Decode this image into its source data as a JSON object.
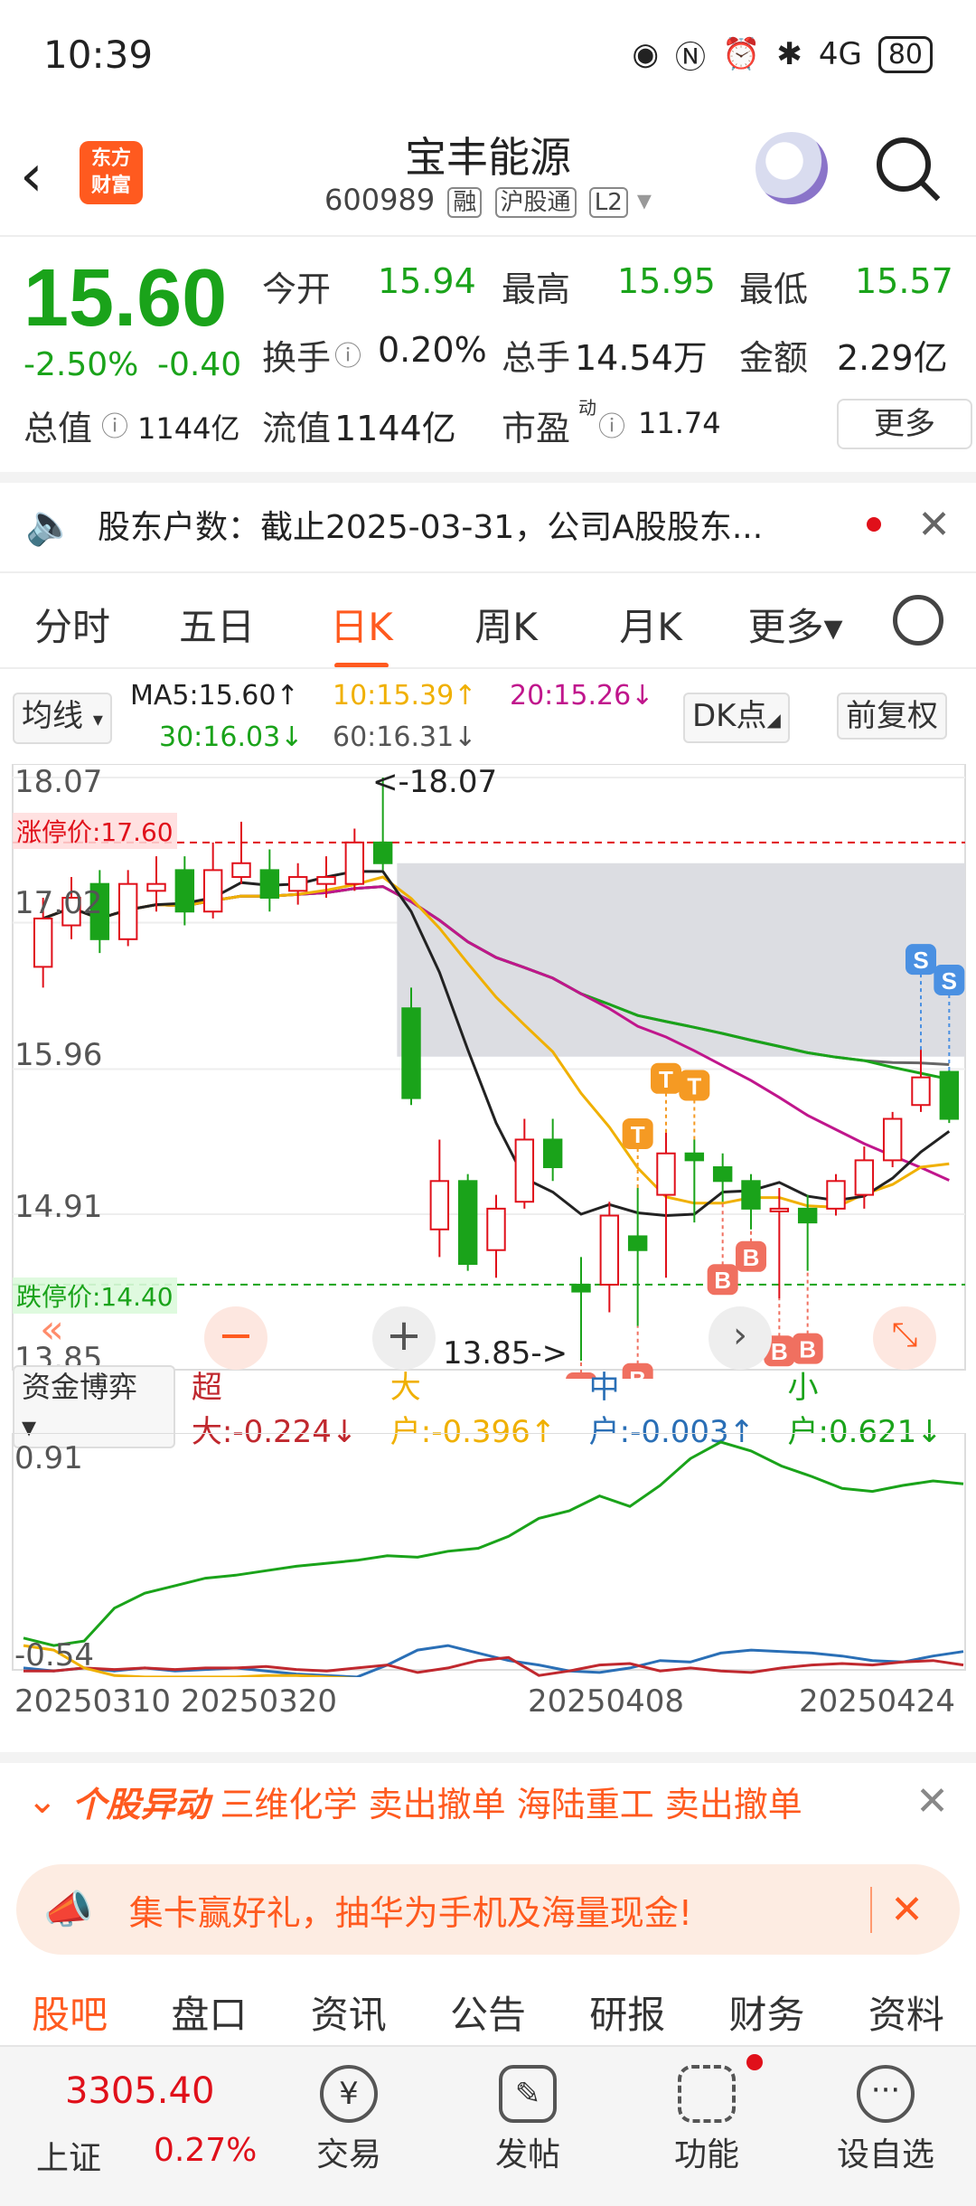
{
  "status": {
    "time": "10:39",
    "signal": "4G",
    "battery": "80"
  },
  "header": {
    "title": "宝丰能源",
    "code": "600989",
    "tags": [
      "融",
      "沪股通",
      "L2"
    ],
    "logo_text": [
      "东方",
      "财富"
    ]
  },
  "quote": {
    "price": "15.60",
    "change_pct": "-2.50%",
    "change": "-0.40",
    "open_label": "今开",
    "open": "15.94",
    "high_label": "最高",
    "high": "15.95",
    "low_label": "最低",
    "low": "15.57",
    "turnover_label": "换手",
    "turnover": "0.20%",
    "volume_label": "总手",
    "volume": "14.54万",
    "amount_label": "金额",
    "amount": "2.29亿",
    "mktcap_label": "总值",
    "mktcap": "1144亿",
    "float_label": "流值",
    "float": "1144亿",
    "pe_label": "市盈",
    "pe_sup": "动",
    "pe": "11.74",
    "more": "更多"
  },
  "notice": {
    "text": "股东户数：截止2025-03-31，公司A股股东..."
  },
  "tabs": [
    "分时",
    "五日",
    "日K",
    "周K",
    "月K",
    "更多▾"
  ],
  "active_tab": 2,
  "ma": {
    "selector": "均线",
    "ma5": "MA5:15.60↑",
    "ma10": "10:15.39↑",
    "ma20": "20:15.26↓",
    "ma30": "30:16.03↓",
    "ma60": "60:16.31↓",
    "dk": "DK点",
    "adjust": "前复权"
  },
  "chart_data": {
    "type": "candlestick",
    "y_ticks": [
      "18.07",
      "17.02",
      "15.96",
      "14.91",
      "13.85"
    ],
    "limit_up_label": "涨停价:17.60",
    "limit_down_label": "跌停价:14.40",
    "max_label": "<-18.07",
    "min_label": "13.85->",
    "ylim": [
      13.85,
      18.07
    ],
    "candles": [
      {
        "o": 16.7,
        "c": 17.05,
        "h": 17.2,
        "l": 16.55
      },
      {
        "o": 17.0,
        "c": 17.2,
        "h": 17.35,
        "l": 16.9
      },
      {
        "o": 17.3,
        "c": 16.9,
        "h": 17.4,
        "l": 16.8
      },
      {
        "o": 16.9,
        "c": 17.3,
        "h": 17.4,
        "l": 16.85
      },
      {
        "o": 17.25,
        "c": 17.3,
        "h": 17.5,
        "l": 17.1
      },
      {
        "o": 17.4,
        "c": 17.1,
        "h": 17.5,
        "l": 17.0
      },
      {
        "o": 17.1,
        "c": 17.4,
        "h": 17.6,
        "l": 17.05
      },
      {
        "o": 17.35,
        "c": 17.45,
        "h": 17.75,
        "l": 17.3
      },
      {
        "o": 17.4,
        "c": 17.2,
        "h": 17.55,
        "l": 17.1
      },
      {
        "o": 17.25,
        "c": 17.35,
        "h": 17.45,
        "l": 17.15
      },
      {
        "o": 17.3,
        "c": 17.35,
        "h": 17.5,
        "l": 17.2
      },
      {
        "o": 17.3,
        "c": 17.6,
        "h": 17.7,
        "l": 17.25
      },
      {
        "o": 17.6,
        "c": 17.45,
        "h": 18.07,
        "l": 17.4
      },
      {
        "o": 16.4,
        "c": 15.75,
        "h": 16.55,
        "l": 15.7
      },
      {
        "o": 14.8,
        "c": 15.15,
        "h": 15.45,
        "l": 14.6
      },
      {
        "o": 15.15,
        "c": 14.55,
        "h": 15.2,
        "l": 14.5
      },
      {
        "o": 14.65,
        "c": 14.95,
        "h": 15.05,
        "l": 14.45
      },
      {
        "o": 15.0,
        "c": 15.45,
        "h": 15.6,
        "l": 14.95
      },
      {
        "o": 15.45,
        "c": 15.25,
        "h": 15.6,
        "l": 15.15
      },
      {
        "o": 14.4,
        "c": 14.35,
        "h": 14.6,
        "l": 13.85
      },
      {
        "o": 14.4,
        "c": 14.9,
        "h": 15.0,
        "l": 14.2
      },
      {
        "o": 14.75,
        "c": 14.65,
        "h": 15.1,
        "l": 14.1
      },
      {
        "o": 15.05,
        "c": 15.35,
        "h": 15.5,
        "l": 14.45
      },
      {
        "o": 15.35,
        "c": 15.3,
        "h": 15.45,
        "l": 14.85
      },
      {
        "o": 15.25,
        "c": 15.15,
        "h": 15.35,
        "l": 15.0
      },
      {
        "o": 15.15,
        "c": 14.95,
        "h": 15.2,
        "l": 14.8
      },
      {
        "o": 14.95,
        "c": 14.95,
        "h": 15.1,
        "l": 14.3
      },
      {
        "o": 14.95,
        "c": 14.85,
        "h": 15.05,
        "l": 14.5
      },
      {
        "o": 14.95,
        "c": 15.15,
        "h": 15.2,
        "l": 14.9
      },
      {
        "o": 15.05,
        "c": 15.3,
        "h": 15.4,
        "l": 14.95
      },
      {
        "o": 15.3,
        "c": 15.6,
        "h": 15.65,
        "l": 15.25
      },
      {
        "o": 15.7,
        "c": 15.9,
        "h": 16.1,
        "l": 15.65
      },
      {
        "o": 15.94,
        "c": 15.6,
        "h": 15.95,
        "l": 15.57
      }
    ],
    "signals": [
      {
        "i": 19,
        "t": "B"
      },
      {
        "i": 21,
        "t": "B"
      },
      {
        "i": 21,
        "t": "T"
      },
      {
        "i": 22,
        "t": "T"
      },
      {
        "i": 23,
        "t": "T"
      },
      {
        "i": 24,
        "t": "B"
      },
      {
        "i": 25,
        "t": "B"
      },
      {
        "i": 26,
        "t": "B"
      },
      {
        "i": 27,
        "t": "B"
      },
      {
        "i": 31,
        "t": "S"
      },
      {
        "i": 32,
        "t": "S"
      }
    ]
  },
  "flow": {
    "selector": "资金博弈",
    "super": "超大:-0.224↓",
    "big": "大户:-0.396↑",
    "mid": "中户:-0.003↑",
    "small": "小户:0.621↓",
    "ymax": "0.91",
    "ymin": "-0.54",
    "dates": [
      "20250310",
      "20250320",
      "20250408",
      "20250424"
    ]
  },
  "alert": {
    "tag": "个股异动",
    "text": "三维化学 卖出撤单 海陆重工 卖出撤单"
  },
  "promo": {
    "text": "集卡赢好礼，抽华为手机及海量现金!"
  },
  "bottom_tabs": [
    "股吧",
    "盘口",
    "资讯",
    "公告",
    "研报",
    "财务",
    "资料"
  ],
  "index": {
    "value": "3305.40",
    "name": "上证",
    "pct": "0.27%"
  },
  "bottom_nav": [
    "交易",
    "发帖",
    "功能",
    "设自选"
  ],
  "colors": {
    "up": "#e0101a",
    "down": "#1aa31a",
    "accent": "#ff5a1f"
  }
}
